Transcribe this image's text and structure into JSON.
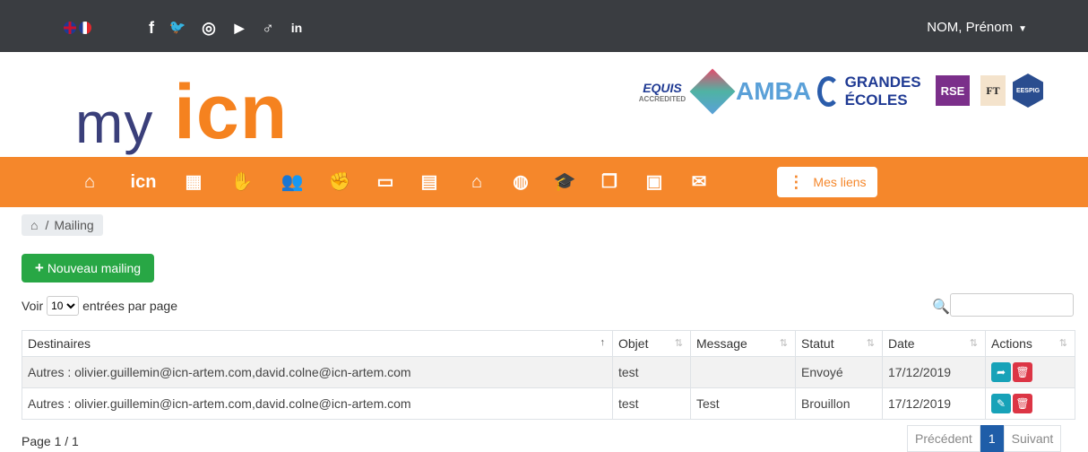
{
  "header": {
    "languages": [
      "English",
      "Français"
    ],
    "social": [
      {
        "icon": "facebook-icon",
        "glyph": "f"
      },
      {
        "icon": "twitter-icon",
        "glyph": "🐦"
      },
      {
        "icon": "instagram-icon",
        "glyph": "◎"
      },
      {
        "icon": "youtube-icon",
        "glyph": "▶"
      },
      {
        "icon": "viadeo-icon",
        "glyph": "♂"
      },
      {
        "icon": "linkedin-icon",
        "glyph": "in"
      }
    ],
    "user": "NOM, Prénom"
  },
  "logo": {
    "my": "my",
    "icn": "icn"
  },
  "accreditations": {
    "equis": "EQUIS",
    "equis_sub": "ACCREDITED",
    "amba": "AMBA",
    "ge": "GRANDES ÉCOLES",
    "rse": "RSE",
    "ft": "FT",
    "eespig": "EESPIG"
  },
  "nav": {
    "items": [
      {
        "icon": "home-icon",
        "glyph": "⌂"
      },
      {
        "icon": "icn-text",
        "glyph": "icn"
      },
      {
        "icon": "building-icon",
        "glyph": "▦"
      },
      {
        "icon": "handshake-icon",
        "glyph": "✋"
      },
      {
        "icon": "users-icon",
        "glyph": "👥"
      },
      {
        "icon": "partners-icon",
        "glyph": "✊"
      },
      {
        "icon": "presentation-icon",
        "glyph": "▭"
      },
      {
        "icon": "calendar-icon",
        "glyph": "▤"
      },
      {
        "icon": "classroom-icon",
        "glyph": "⌂"
      },
      {
        "icon": "globe-icon",
        "glyph": "◍"
      },
      {
        "icon": "graduation-cap-icon",
        "glyph": "🎓"
      },
      {
        "icon": "documents-icon",
        "glyph": "❐"
      },
      {
        "icon": "contact-card-icon",
        "glyph": "▣"
      },
      {
        "icon": "envelope-icon",
        "glyph": "✉"
      }
    ],
    "mes_liens": "Mes liens"
  },
  "breadcrumb": {
    "current": "Mailing"
  },
  "toolbar": {
    "new_mailing": "Nouveau mailing"
  },
  "table_controls": {
    "show": "Voir",
    "page_length": "10",
    "per_page": "entrées par page"
  },
  "table": {
    "columns": [
      "Destinaires",
      "Objet",
      "Message",
      "Statut",
      "Date",
      "Actions"
    ],
    "rows": [
      {
        "destinataires": "Autres : olivier.guillemin@icn-artem.com,david.colne@icn-artem.com",
        "objet": "test",
        "message": "",
        "statut": "Envoyé",
        "date": "17/12/2019"
      },
      {
        "destinataires": "Autres : olivier.guillemin@icn-artem.com,david.colne@icn-artem.com",
        "objet": "test",
        "message": "Test",
        "statut": "Brouillon",
        "date": "17/12/2019"
      }
    ]
  },
  "pagination": {
    "info": "Page 1 / 1",
    "previous": "Précédent",
    "current": "1",
    "next": "Suivant"
  }
}
